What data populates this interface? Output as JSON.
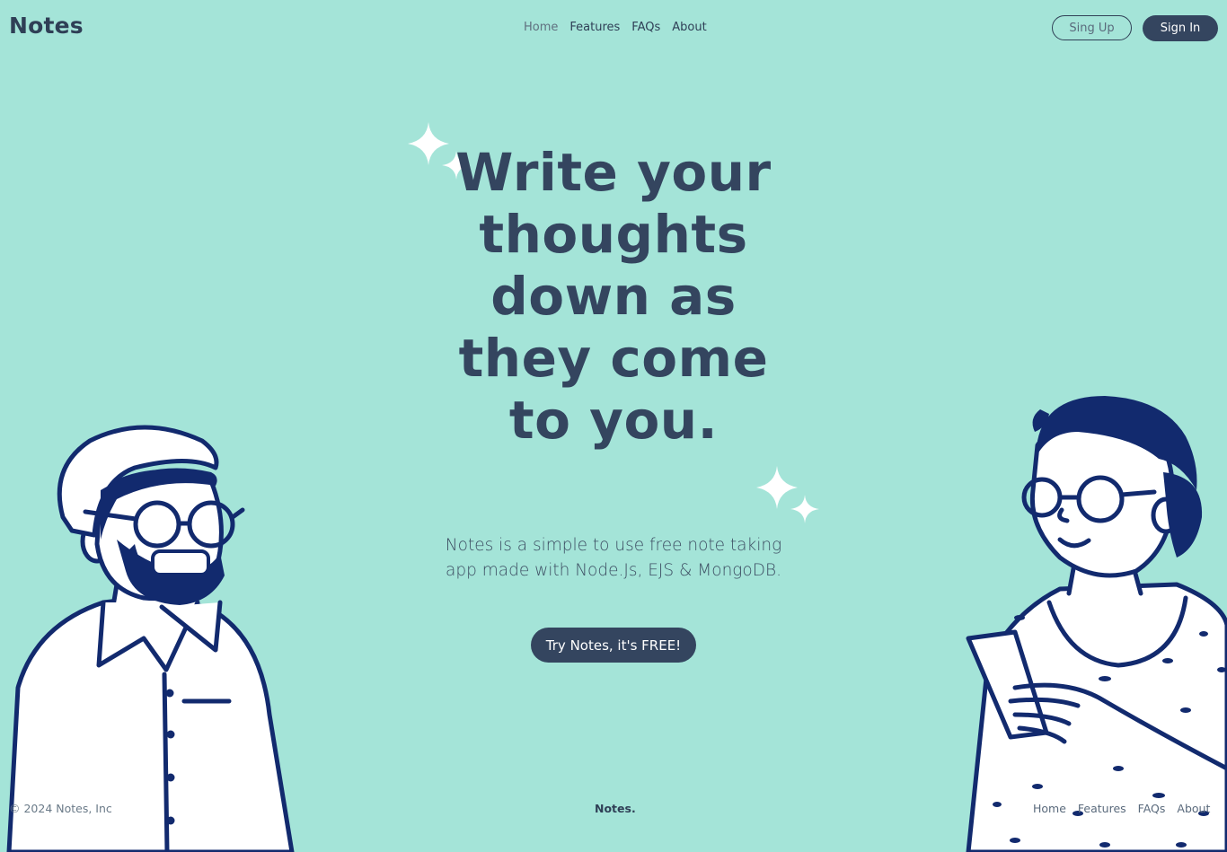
{
  "header": {
    "logo": "Notes",
    "nav": [
      "Home",
      "Features",
      "FAQs",
      "About"
    ],
    "signup_label": "Sing Up",
    "signin_label": "Sign In"
  },
  "hero": {
    "title": "Write your thoughts down as they come to you.",
    "description": "Notes is a simple to use free note taking app made with Node.Js, EJS & MongoDB.",
    "cta_label": "Try Notes, it's FREE!"
  },
  "footer": {
    "copyright": "© 2024 Notes, Inc",
    "brand": "Notes.",
    "nav": [
      "Home",
      "Features",
      "FAQs",
      "About"
    ]
  },
  "colors": {
    "background": "#a4e4d8",
    "primary": "#34455f",
    "illustration_ink": "#122a6e",
    "sparkle": "#ffffff"
  },
  "icons": [
    "sparkle-icon",
    "man-illustration",
    "woman-illustration"
  ]
}
